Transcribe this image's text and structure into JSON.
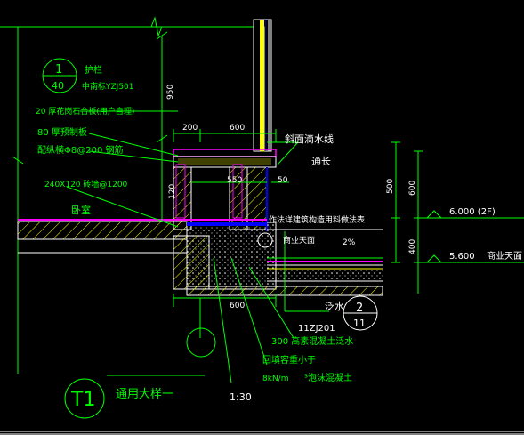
{
  "colors": {
    "background": "#000000",
    "green": "#00ff00",
    "yellow": "#ffff00",
    "white": "#ffffff",
    "magenta": "#ff00ff",
    "blue": "#0000ff",
    "hatch": "#ffff00"
  },
  "labels": {
    "callout_left_top": "1",
    "callout_left_bottom": "40",
    "railing": "护栏",
    "railing_ref": "中南标YZJ501",
    "granite": "20 厚花岗石台板(用户自理)",
    "slab": "80 厚预制板",
    "rebar": "配纵横Φ8@200  钢筋",
    "wall": "240X120    砖墙@1200",
    "bedroom": "卧室",
    "drip": "斜面滴水线",
    "drip_sub": "通长",
    "shop_canopy": "商业天面",
    "see_method": "作法详建筑构造用料做法表",
    "flashing": "泛水",
    "std": "11ZJ201",
    "concrete_flash": "300  高素混凝土泛水",
    "backfill": "回填容重小于",
    "backfill_2": "8kN/m",
    "foam": "³泡沫混凝土",
    "callout_right_top": "2",
    "callout_right_bottom": "11",
    "title_tag": "T1",
    "title": "通用大样一",
    "scale": "1:30",
    "elev_2f": "6.000  (2F)",
    "elev_shop": "5.600",
    "elev_shop_label": "商业天面",
    "slope": "2%"
  },
  "dimensions": {
    "d950": "950",
    "d200": "200",
    "d600_top": "600",
    "d550": "550",
    "d50": "50",
    "d120": "120",
    "d500": "500",
    "d600_right": "600",
    "d400": "400",
    "d600_bottom": "600"
  }
}
